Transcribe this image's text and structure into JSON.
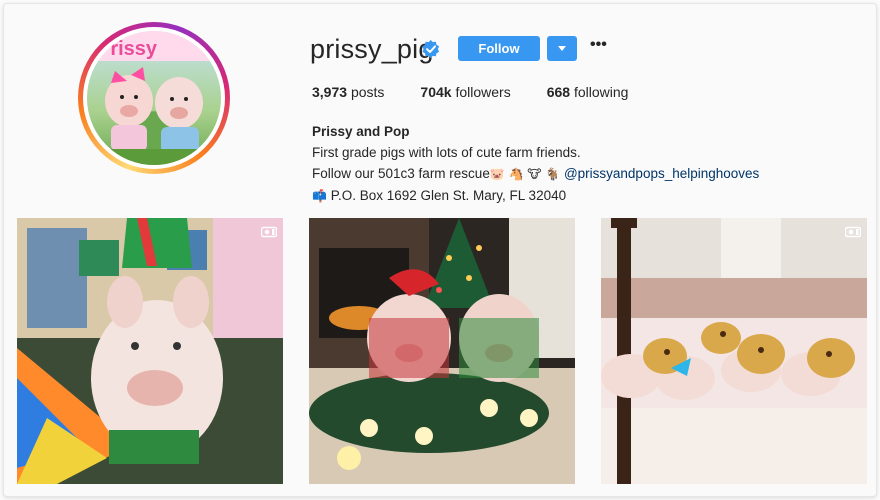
{
  "profile": {
    "username": "prissy_pig",
    "verified": true,
    "follow_label": "Follow",
    "stats": {
      "posts_count": "3,973",
      "posts_label": "posts",
      "followers_count": "704k",
      "followers_label": "followers",
      "following_count": "668",
      "following_label": "following"
    },
    "bio": {
      "name": "Prissy and Pop",
      "line1": "First grade pigs with lots of cute farm friends.",
      "line2_text": "Follow our 501c3 farm rescue",
      "line2_emojis": [
        "🐷",
        "🐴",
        "🐮",
        "🐐"
      ],
      "link": "@prissyandpops_helpinghooves",
      "mailbox_emoji": "📫",
      "address": "P.O. Box 1692 Glen St. Mary, FL 32040"
    }
  },
  "posts": [
    {
      "type": "video",
      "icon": "video-icon"
    },
    {
      "type": "image"
    },
    {
      "type": "video",
      "icon": "video-icon"
    }
  ],
  "colors": {
    "accent": "#3897f0",
    "link": "#003569",
    "text": "#262626",
    "background": "#fafafa"
  }
}
